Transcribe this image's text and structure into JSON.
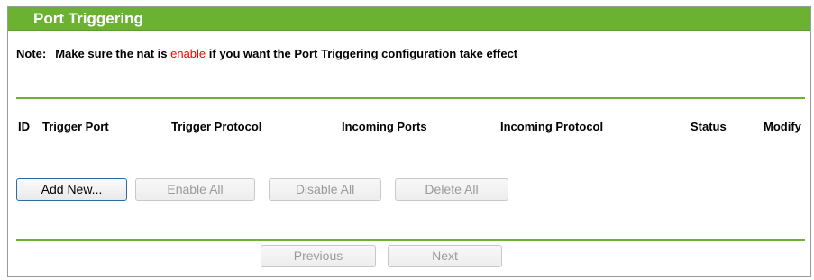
{
  "title": "Port Triggering",
  "note": {
    "label": "Note:",
    "text_before": "Make sure the nat is ",
    "highlight": "enable",
    "text_after": " if you want the Port Triggering configuration take effect"
  },
  "table": {
    "columns": [
      "ID",
      "Trigger Port",
      "Trigger Protocol",
      "Incoming Ports",
      "Incoming Protocol",
      "Status",
      "Modify"
    ],
    "rows": []
  },
  "actions": {
    "add_new": "Add New...",
    "enable_all": "Enable All",
    "disable_all": "Disable All",
    "delete_all": "Delete All"
  },
  "pagination": {
    "previous": "Previous",
    "next": "Next"
  },
  "colors": {
    "accent_green": "#6bb233",
    "highlight_red": "#ff0000"
  }
}
